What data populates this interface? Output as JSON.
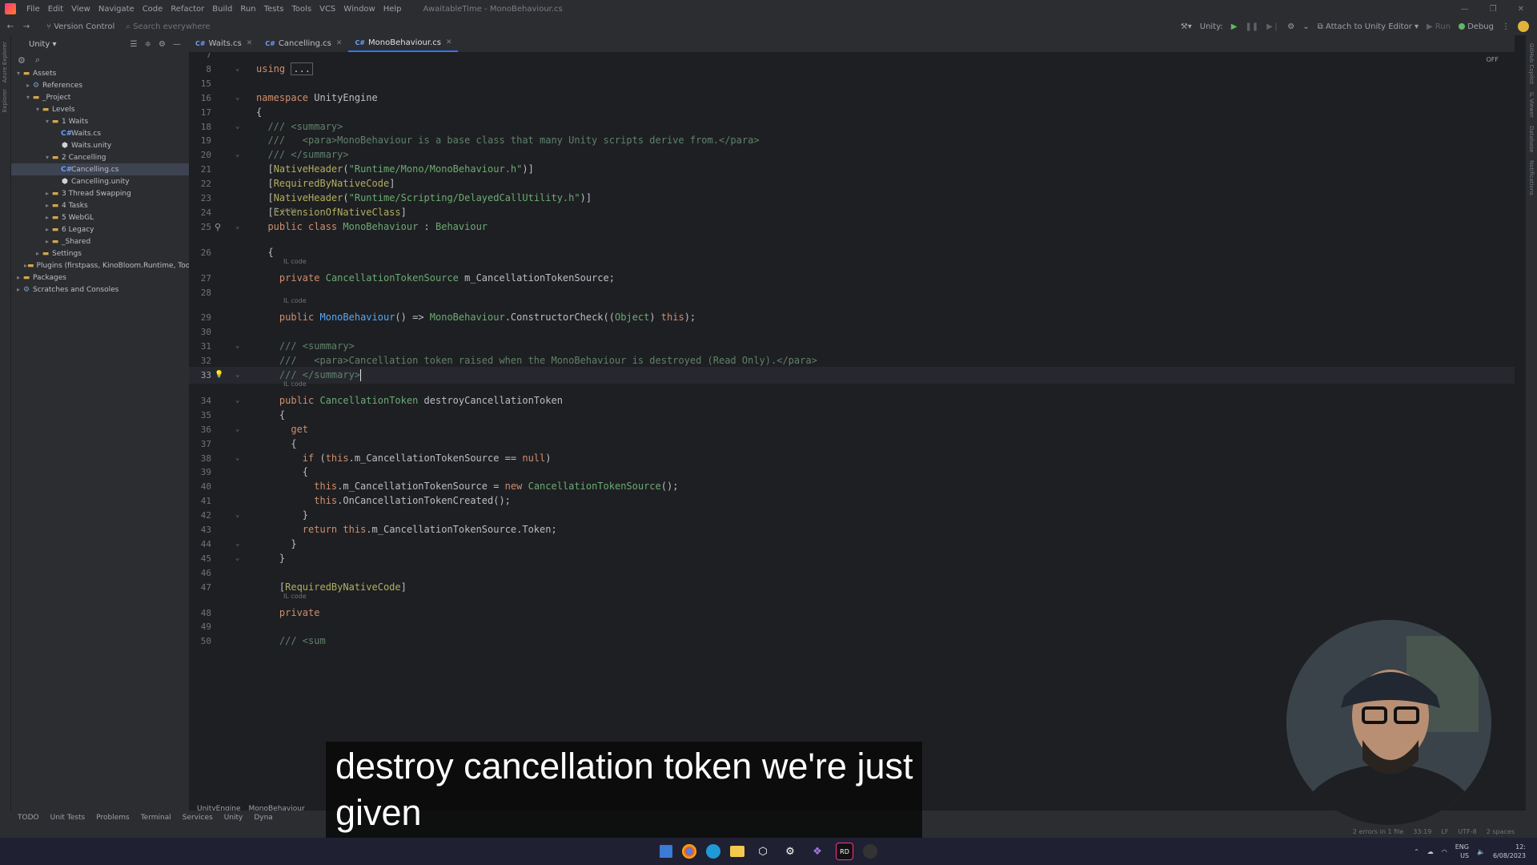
{
  "menubar": {
    "items": [
      "File",
      "Edit",
      "View",
      "Navigate",
      "Code",
      "Refactor",
      "Build",
      "Run",
      "Tests",
      "Tools",
      "VCS",
      "Window",
      "Help"
    ],
    "window_title": "AwaitableTime - MonoBehaviour.cs"
  },
  "toolbar": {
    "version_control": "Version Control",
    "search_placeholder": "Search everywhere",
    "unity_label": "Unity:",
    "attach_label": "Attach to Unity Editor",
    "run_label": "Run",
    "debug_label": "Debug"
  },
  "project": {
    "title": "Unity",
    "tree": [
      {
        "label": "Assets",
        "depth": 0,
        "arrow": "▾",
        "icon": "folder"
      },
      {
        "label": "References",
        "depth": 1,
        "arrow": "▸",
        "icon": "ref"
      },
      {
        "label": "_Project",
        "depth": 1,
        "arrow": "▾",
        "icon": "folder"
      },
      {
        "label": "Levels",
        "depth": 2,
        "arrow": "▾",
        "icon": "folder"
      },
      {
        "label": "1 Waits",
        "depth": 3,
        "arrow": "▾",
        "icon": "folder"
      },
      {
        "label": "Waits.cs",
        "depth": 4,
        "arrow": "",
        "icon": "cs"
      },
      {
        "label": "Waits.unity",
        "depth": 4,
        "arrow": "",
        "icon": "unity"
      },
      {
        "label": "2 Cancelling",
        "depth": 3,
        "arrow": "▾",
        "icon": "folder"
      },
      {
        "label": "Cancelling.cs",
        "depth": 4,
        "arrow": "",
        "icon": "cs",
        "selected": true
      },
      {
        "label": "Cancelling.unity",
        "depth": 4,
        "arrow": "",
        "icon": "unity"
      },
      {
        "label": "3 Thread Swapping",
        "depth": 3,
        "arrow": "▸",
        "icon": "folder"
      },
      {
        "label": "4 Tasks",
        "depth": 3,
        "arrow": "▸",
        "icon": "folder"
      },
      {
        "label": "5 WebGL",
        "depth": 3,
        "arrow": "▸",
        "icon": "folder"
      },
      {
        "label": "6 Legacy",
        "depth": 3,
        "arrow": "▸",
        "icon": "folder"
      },
      {
        "label": "_Shared",
        "depth": 3,
        "arrow": "▸",
        "icon": "folder"
      },
      {
        "label": "Settings",
        "depth": 2,
        "arrow": "▸",
        "icon": "folder"
      },
      {
        "label": "Plugins (firstpass, KinoBloom.Runtime, Toon",
        "depth": 1,
        "arrow": "▸",
        "icon": "folder"
      },
      {
        "label": "Packages",
        "depth": 0,
        "arrow": "▸",
        "icon": "folder"
      },
      {
        "label": "Scratches and Consoles",
        "depth": 0,
        "arrow": "▸",
        "icon": "ref"
      }
    ]
  },
  "tabs": [
    {
      "label": "Waits.cs",
      "active": false
    },
    {
      "label": "Cancelling.cs",
      "active": false
    },
    {
      "label": "MonoBehaviour.cs",
      "active": true
    }
  ],
  "editor": {
    "off_label": "OFF",
    "il_code": "IL code",
    "current_line": "33",
    "lines": [
      {
        "n": "7",
        "html": ""
      },
      {
        "n": "8",
        "html": "<span class='k'>using</span> <span class='rg'>...</span>"
      },
      {
        "n": "15",
        "html": ""
      },
      {
        "n": "16",
        "html": "<span class='k'>namespace</span> UnityEngine"
      },
      {
        "n": "17",
        "html": "{"
      },
      {
        "n": "18",
        "html": "  <span class='d'>/// &lt;summary&gt;</span>"
      },
      {
        "n": "19",
        "html": "  <span class='d'>///   &lt;para&gt;MonoBehaviour is a base class that many Unity scripts derive from.&lt;/para&gt;</span>"
      },
      {
        "n": "20",
        "html": "  <span class='d'>/// &lt;/summary&gt;</span>"
      },
      {
        "n": "21",
        "html": "  [<span class='at'>NativeHeader</span>(<span class='s'>\"Runtime/Mono/MonoBehaviour.h\"</span>)]"
      },
      {
        "n": "22",
        "html": "  [<span class='at'>RequiredByNativeCode</span>]"
      },
      {
        "n": "23",
        "html": "  [<span class='at'>NativeHeader</span>(<span class='s'>\"Runtime/Scripting/DelayedCallUtility.h\"</span>)]"
      },
      {
        "n": "24",
        "html": "  [<span class='at'>ExtensionOfNativeClass</span>]"
      },
      {
        "n": "25",
        "html": "  <span class='k'>public class</span> <span class='cl'>MonoBehaviour</span> : <span class='cl'>Behaviour</span>"
      },
      {
        "n": "26",
        "html": "  {"
      },
      {
        "n": "27",
        "html": "    <span class='k'>private</span> <span class='cl'>CancellationTokenSource</span> m_CancellationTokenSource;"
      },
      {
        "n": "28",
        "html": ""
      },
      {
        "n": "29",
        "html": "    <span class='k'>public</span> <span class='mt'>MonoBehaviour</span>() =&gt; <span class='cl'>MonoBehaviour</span>.ConstructorCheck((<span class='cl'>Object</span>) <span class='k'>this</span>);"
      },
      {
        "n": "30",
        "html": ""
      },
      {
        "n": "31",
        "html": "    <span class='d'>/// &lt;summary&gt;</span>"
      },
      {
        "n": "32",
        "html": "    <span class='d'>///   &lt;para&gt;Cancellation token raised when the MonoBehaviour is destroyed (Read Only).&lt;/para&gt;</span>"
      },
      {
        "n": "33",
        "html": "    <span class='d'>/// &lt;/summary&gt;</span><span class='caret'></span>"
      },
      {
        "n": "34",
        "html": "    <span class='k'>public</span> <span class='cl'>CancellationToken</span> destroyCancellationToken"
      },
      {
        "n": "35",
        "html": "    {"
      },
      {
        "n": "36",
        "html": "      <span class='k'>get</span>"
      },
      {
        "n": "37",
        "html": "      {"
      },
      {
        "n": "38",
        "html": "        <span class='k'>if</span> (<span class='k'>this</span>.m_CancellationTokenSource == <span class='k'>null</span>)"
      },
      {
        "n": "39",
        "html": "        {"
      },
      {
        "n": "40",
        "html": "          <span class='k'>this</span>.m_CancellationTokenSource = <span class='k'>new</span> <span class='cl'>CancellationTokenSource</span>();"
      },
      {
        "n": "41",
        "html": "          <span class='k'>this</span>.OnCancellationTokenCreated();"
      },
      {
        "n": "42",
        "html": "        }"
      },
      {
        "n": "43",
        "html": "        <span class='k'>return</span> <span class='k'>this</span>.m_CancellationTokenSource.Token;"
      },
      {
        "n": "44",
        "html": "      }"
      },
      {
        "n": "45",
        "html": "    }"
      },
      {
        "n": "46",
        "html": ""
      },
      {
        "n": "47",
        "html": "    [<span class='at'>RequiredByNativeCode</span>]"
      },
      {
        "n": "48",
        "html": "    <span class='k'>private</span>"
      },
      {
        "n": "49",
        "html": ""
      },
      {
        "n": "50",
        "html": "    <span class='d'>/// &lt;sum</span>"
      }
    ]
  },
  "breadcrumb": [
    "UnityEngine",
    "MonoBehaviour"
  ],
  "bottom_tabs": [
    "TODO",
    "Unit Tests",
    "Problems",
    "Terminal",
    "Services",
    "Unity",
    "Dyna"
  ],
  "status": {
    "errors": "2 errors in 1 file",
    "position": "33:19",
    "line_sep": "LF",
    "encoding": "UTF-8",
    "indent": "2 spaces"
  },
  "taskbar": {
    "lang": "ENG",
    "region": "US",
    "time": "12:",
    "date": "6/08/2023"
  },
  "subtitle": {
    "line1": "destroy cancellation token we're just",
    "line2": "given"
  }
}
